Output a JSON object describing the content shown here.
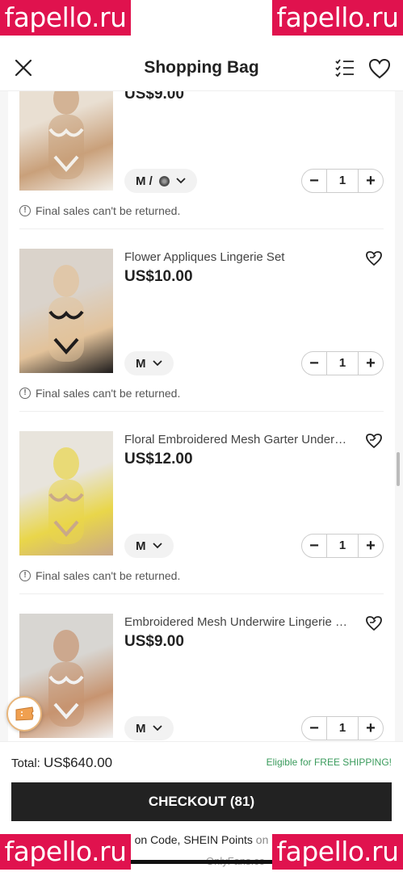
{
  "header": {
    "title": "Shopping Bag",
    "close_icon": "close-icon",
    "list_icon": "checklist-icon",
    "wishlist_icon": "heart-icon"
  },
  "items": [
    {
      "name": "",
      "price": "US$9.00",
      "size": "M /",
      "has_color_dot": true,
      "quantity": "1",
      "note": "Final sales can't be returned.",
      "thumb_colors": [
        "#e9dfd2",
        "#c9a07a",
        "#f3f0ea"
      ]
    },
    {
      "name": "Flower Appliques Lingerie Set",
      "price": "US$10.00",
      "size": "M",
      "has_color_dot": false,
      "quantity": "1",
      "note": "Final sales can't be returned.",
      "thumb_colors": [
        "#dad3cb",
        "#e2c29a",
        "#1e1c1c"
      ]
    },
    {
      "name": "Floral Embroidered Mesh Garter Underwear Set",
      "price": "US$12.00",
      "size": "M",
      "has_color_dot": false,
      "quantity": "1",
      "note": "Final sales can't be returned.",
      "thumb_colors": [
        "#e8e4dc",
        "#e9d64a",
        "#c9a889"
      ]
    },
    {
      "name": "Embroidered Mesh Underwire Lingerie Set",
      "price": "US$9.00",
      "size": "M",
      "has_color_dot": false,
      "quantity": "1",
      "note": "",
      "thumb_colors": [
        "#d8d6d2",
        "#c79470",
        "#f2f2f2"
      ]
    }
  ],
  "stepper": {
    "minus": "−",
    "plus": "+"
  },
  "footer": {
    "total_label": "Total:",
    "total_value": "US$640.00",
    "shipping": "Eligible for FREE SHIPPING!",
    "checkout": "CHECKOUT (81)",
    "promo_text": "on Code, SHEIN Points",
    "promo_on": "on",
    "onlyfans": "OnlyFans.co"
  },
  "watermark": "fapello.ru",
  "colors": {
    "watermark": "#e0124e",
    "checkout_bg": "#222222",
    "shipping": "#3a9b5c"
  }
}
